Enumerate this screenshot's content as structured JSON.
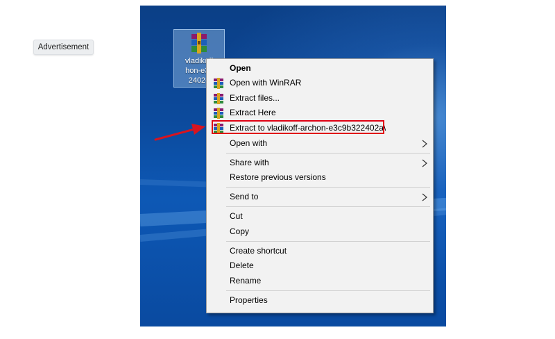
{
  "advertisement_label": "Advertisement",
  "desktop_icon": {
    "icon": "winrar-archive-icon",
    "label_lines": [
      "vladikoff",
      "hon-e3c",
      "24024"
    ]
  },
  "context_menu": {
    "items": [
      {
        "label": "Open",
        "bold": true,
        "icon": null
      },
      {
        "label": "Open with WinRAR",
        "icon": "winrar-icon"
      },
      {
        "label": "Extract files...",
        "icon": "winrar-icon"
      },
      {
        "label": "Extract Here",
        "icon": "winrar-icon"
      },
      {
        "label": "Extract to vladikoff-archon-e3c9b322402a\\",
        "icon": "winrar-icon",
        "highlighted": true
      },
      {
        "label": "Open with",
        "submenu": true
      },
      {
        "label": "Share with",
        "submenu": true
      },
      {
        "label": "Restore previous versions"
      },
      {
        "label": "Send to",
        "submenu": true
      },
      {
        "label": "Cut"
      },
      {
        "label": "Copy"
      },
      {
        "label": "Create shortcut"
      },
      {
        "label": "Delete"
      },
      {
        "label": "Rename"
      },
      {
        "label": "Properties"
      }
    ]
  },
  "colors": {
    "highlight_border": "#e00012",
    "arrow": "#d8141f",
    "desktop_blue": "#0c4a9c",
    "menu_background": "#f2f2f2"
  }
}
